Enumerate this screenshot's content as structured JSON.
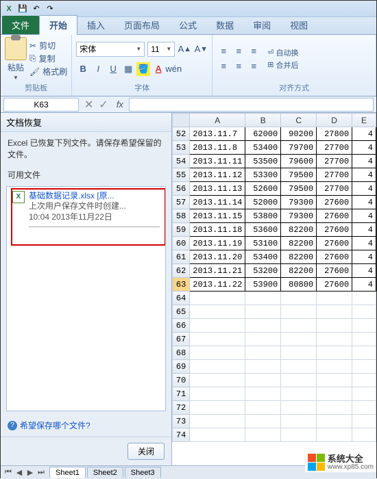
{
  "qat": {
    "save": "💾",
    "undo": "↶",
    "redo": "↷"
  },
  "tabs": {
    "file": "文件",
    "home": "开始",
    "insert": "插入",
    "layout": "页面布局",
    "formula": "公式",
    "data": "数据",
    "review": "审阅",
    "view": "视图"
  },
  "ribbon": {
    "clipboard": {
      "paste": "粘贴",
      "cut": "剪切",
      "copy": "复制",
      "format_painter": "格式刷",
      "label": "剪贴板"
    },
    "font": {
      "name": "宋体",
      "size": "11",
      "bold": "B",
      "italic": "I",
      "underline": "U",
      "label": "字体"
    },
    "align": {
      "wrap": "自动换",
      "merge": "合并后",
      "label": "对齐方式"
    }
  },
  "namebox": "K63",
  "fx": "fx",
  "recovery": {
    "title": "文档恢复",
    "message": "Excel 已恢复下列文件。请保存希望保留的文件。",
    "available": "可用文件",
    "item": {
      "name": "基础数据记录.xlsx  [原...",
      "line2": "上次用户保存文件时创建...",
      "line3": "10:04 2013年11月22日"
    },
    "help": "希望保存哪个文件?",
    "close": "关闭"
  },
  "columns": [
    "A",
    "B",
    "C",
    "D",
    "E"
  ],
  "rows": [
    {
      "n": 52,
      "d": "2013.11.7",
      "a": "62000",
      "b": "90200",
      "c": "27800",
      "e": "4"
    },
    {
      "n": 53,
      "d": "2013.11.8",
      "a": "53400",
      "b": "79700",
      "c": "27700",
      "e": "4"
    },
    {
      "n": 54,
      "d": "2013.11.11",
      "a": "53500",
      "b": "79600",
      "c": "27700",
      "e": "4"
    },
    {
      "n": 55,
      "d": "2013.11.12",
      "a": "53300",
      "b": "79500",
      "c": "27700",
      "e": "4"
    },
    {
      "n": 56,
      "d": "2013.11.13",
      "a": "52600",
      "b": "79500",
      "c": "27700",
      "e": "4"
    },
    {
      "n": 57,
      "d": "2013.11.14",
      "a": "52000",
      "b": "79300",
      "c": "27600",
      "e": "4"
    },
    {
      "n": 58,
      "d": "2013.11.15",
      "a": "53800",
      "b": "79300",
      "c": "27600",
      "e": "4"
    },
    {
      "n": 59,
      "d": "2013.11.18",
      "a": "53600",
      "b": "82200",
      "c": "27600",
      "e": "4"
    },
    {
      "n": 60,
      "d": "2013.11.19",
      "a": "53100",
      "b": "82200",
      "c": "27600",
      "e": "4"
    },
    {
      "n": 61,
      "d": "2013.11.20",
      "a": "53400",
      "b": "82200",
      "c": "27600",
      "e": "4"
    },
    {
      "n": 62,
      "d": "2013.11.21",
      "a": "53200",
      "b": "82200",
      "c": "27600",
      "e": "4"
    },
    {
      "n": 63,
      "d": "2013.11.22",
      "a": "53900",
      "b": "80800",
      "c": "27600",
      "e": "4",
      "sel": true
    }
  ],
  "empty_rows": [
    64,
    65,
    66,
    67,
    68,
    69,
    70,
    71,
    72,
    73,
    74
  ],
  "sheets": {
    "s1": "Sheet1",
    "s2": "Sheet2",
    "s3": "Sheet3"
  },
  "watermark": {
    "title": "系统大全",
    "url": "www.xp85.com"
  }
}
